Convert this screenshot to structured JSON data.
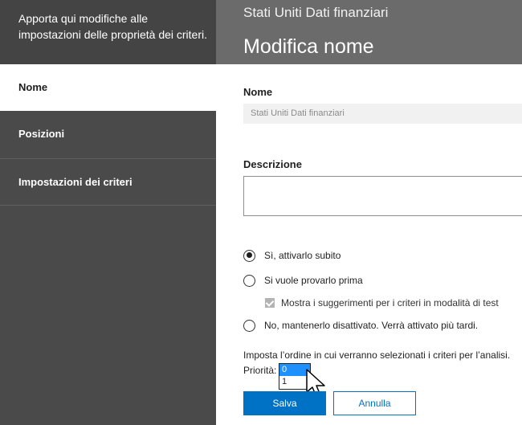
{
  "sidebar": {
    "intro": "Apporta qui modifiche alle impostazioni delle proprietà dei criteri.",
    "items": [
      {
        "label": "Nome"
      },
      {
        "label": "Posizioni"
      },
      {
        "label": "Impostazioni dei criteri"
      }
    ]
  },
  "header": {
    "subtitle": "Stati Uniti Dati finanziari",
    "title": "Modifica nome"
  },
  "form": {
    "name_label": "Nome",
    "name_value": "Stati Uniti Dati finanziari",
    "description_label": "Descrizione",
    "description_value": "",
    "options": [
      {
        "label": "Sì, attivarlo subito",
        "selected": true
      },
      {
        "label": "Si vuole provarlo prima",
        "selected": false
      },
      {
        "label": "No, mantenerlo disattivato. Verrà attivato più tardi.",
        "selected": false
      }
    ],
    "test_checkbox_label": "Mostra i suggerimenti per i criteri in modalità di test",
    "test_checkbox_checked": true,
    "order_text": "Imposta l’ordine in cui verranno selezionati i criteri per l’analisi.",
    "priority_label": "Priorità:",
    "priority_options": [
      "0",
      "1"
    ],
    "priority_selected": "0"
  },
  "buttons": {
    "save": "Salva",
    "cancel": "Annulla"
  },
  "colors": {
    "accent": "#0072c6",
    "sidebar": "#4a4a4a",
    "header": "#6b6b6b",
    "selection": "#1e90ff"
  }
}
